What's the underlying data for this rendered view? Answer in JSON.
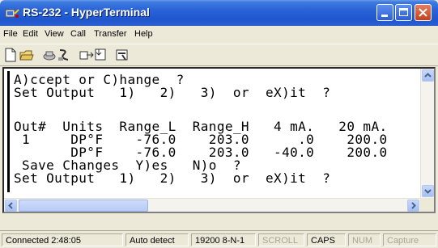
{
  "window": {
    "title": "RS-232 - HyperTerminal"
  },
  "menu": [
    "File",
    "Edit",
    "View",
    "Call",
    "Transfer",
    "Help"
  ],
  "toolbar": [
    "new-icon",
    "open-icon",
    "disconnect-icon",
    "dial-icon",
    "send-icon",
    "receive-icon",
    "properties-icon"
  ],
  "terminal": {
    "lines": [
      "A)ccept or C)hange  ?",
      "Set Output   1)   2)   3)  or  eX)it  ?",
      "",
      "Out#  Units  Range_L  Range_H   4 mA.   20 mA.",
      " 1     DP°F    -76.0    203.0      .0    200.0",
      "       DP°F    -76.0    203.0   -40.0    200.0",
      " Save Changes  Y)es   N)o  ?",
      "Set Output   1)   2)   3)  or  eX)it  ?"
    ]
  },
  "status": {
    "connected": "Connected 2:48:05",
    "detect": "Auto detect",
    "settings": "19200 8-N-1",
    "scroll": "SCROLL",
    "caps": "CAPS",
    "num": "NUM",
    "capture": "Capture"
  }
}
